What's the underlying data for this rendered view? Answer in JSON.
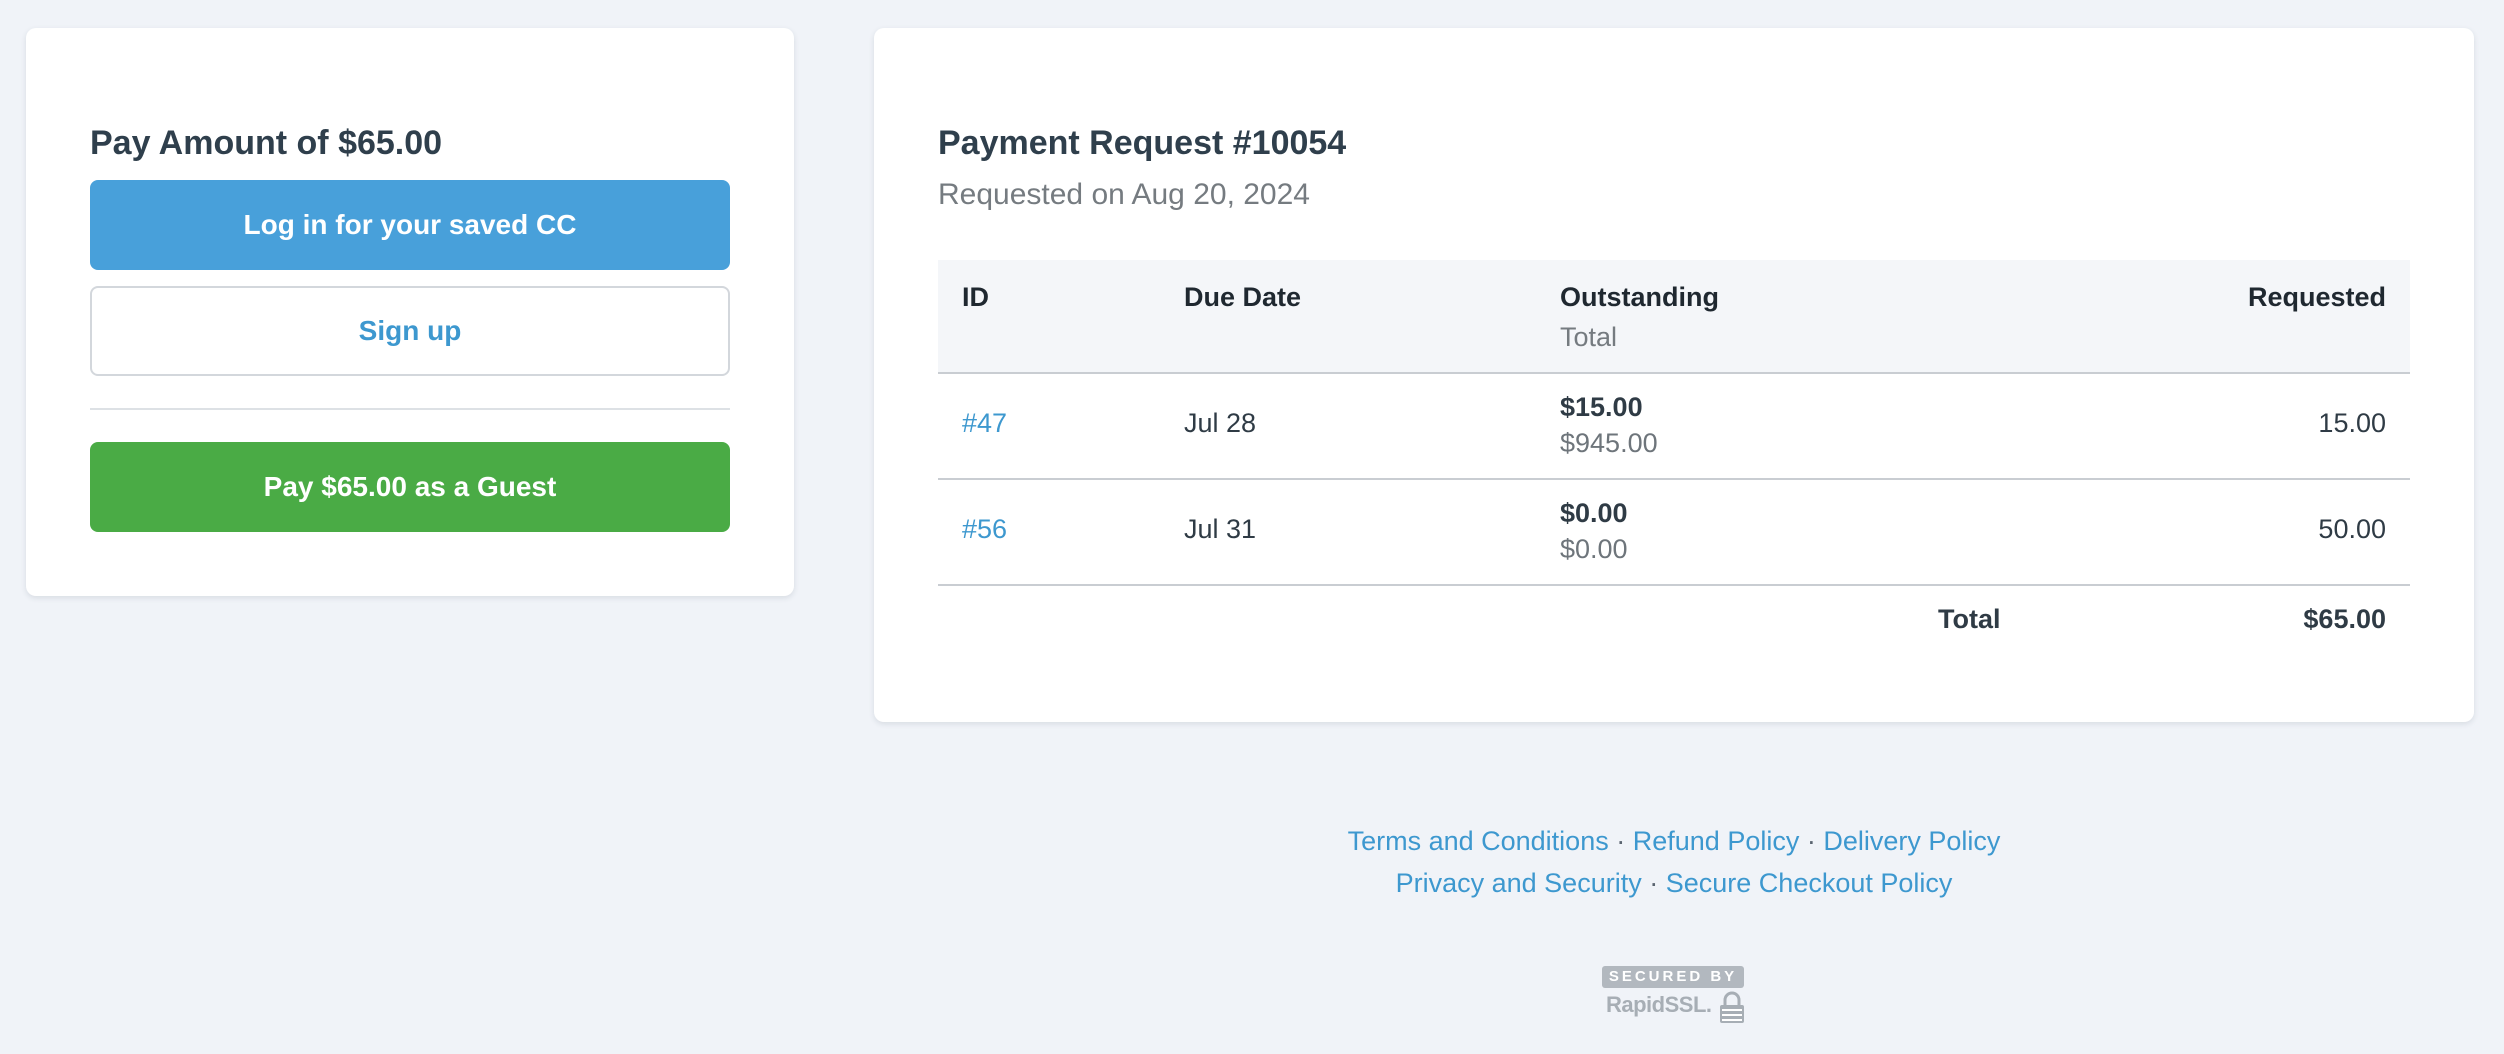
{
  "pay_panel": {
    "title": "Pay Amount of $65.00",
    "login_button": "Log in for your saved CC",
    "signup_button": "Sign up",
    "guest_button": "Pay $65.00 as a Guest"
  },
  "request": {
    "title": "Payment Request #10054",
    "subtitle": "Requested on Aug 20, 2024",
    "columns": {
      "id": "ID",
      "due_date": "Due Date",
      "outstanding": "Outstanding",
      "outstanding_sub": "Total",
      "requested": "Requested"
    },
    "rows": [
      {
        "id": "#47",
        "due_date": "Jul 28",
        "outstanding": "$15.00",
        "total": "$945.00",
        "requested": "15.00"
      },
      {
        "id": "#56",
        "due_date": "Jul 31",
        "outstanding": "$0.00",
        "total": "$0.00",
        "requested": "50.00"
      }
    ],
    "total_label": "Total",
    "total_value": "$65.00"
  },
  "footer": {
    "links": [
      "Terms and Conditions",
      "Refund Policy",
      "Delivery Policy",
      "Privacy and Security",
      "Secure Checkout Policy"
    ],
    "separator": "·",
    "ssl_top": "SECURED BY",
    "ssl_brand": "RapidSSL."
  },
  "colors": {
    "background": "#f0f3f8",
    "login_button": "#48a0da",
    "guest_button": "#4aab45",
    "link": "#3d98cf"
  },
  "icons": {
    "ssl_lock": "padlock-icon"
  }
}
